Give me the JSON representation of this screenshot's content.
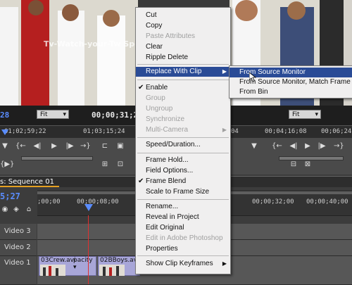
{
  "source_monitor": {
    "timecode_in": "28",
    "fit_label": "Fit",
    "timecode_current": "00;00;31;2",
    "ruler": [
      "01;02;59;22",
      "01;03;15;24"
    ],
    "watermark": "Tv-Watch-your-Tw Sports.com"
  },
  "program_monitor": {
    "fit_label": "Fit",
    "ruler": [
      "04",
      "00;04;16;08",
      "00;06;24;"
    ]
  },
  "timeline": {
    "tab_label": "s: Sequence 01",
    "timecode": "5;27",
    "ruler": [
      ";00;00",
      "00;00;08;00",
      "00;00;32;00",
      "00;00;40;00"
    ],
    "tracks": [
      {
        "label": "Video 3"
      },
      {
        "label": "Video 2"
      },
      {
        "label": "Video 1"
      }
    ],
    "clips": [
      {
        "label": "03Crew.avi",
        "extra": "pacity ▾"
      },
      {
        "label": "02BBoys.avi"
      }
    ]
  },
  "context_menu": {
    "items": [
      {
        "label": "Cut",
        "enabled": true
      },
      {
        "label": "Copy",
        "enabled": true
      },
      {
        "label": "Paste Attributes",
        "enabled": false
      },
      {
        "label": "Clear",
        "enabled": true
      },
      {
        "label": "Ripple Delete",
        "enabled": true
      },
      {
        "label": "Replace With Clip",
        "enabled": true,
        "submenu": true,
        "highlighted": true
      },
      {
        "label": "Enable",
        "enabled": true,
        "checked": true
      },
      {
        "label": "Group",
        "enabled": false
      },
      {
        "label": "Ungroup",
        "enabled": false
      },
      {
        "label": "Synchronize",
        "enabled": false
      },
      {
        "label": "Multi-Camera",
        "enabled": false,
        "submenu": true
      },
      {
        "label": "Speed/Duration...",
        "enabled": true
      },
      {
        "label": "Frame Hold...",
        "enabled": true
      },
      {
        "label": "Field Options...",
        "enabled": true
      },
      {
        "label": "Frame Blend",
        "enabled": true,
        "checked": true
      },
      {
        "label": "Scale to Frame Size",
        "enabled": true
      },
      {
        "label": "Rename...",
        "enabled": true
      },
      {
        "label": "Reveal in Project",
        "enabled": true
      },
      {
        "label": "Edit Original",
        "enabled": true
      },
      {
        "label": "Edit in Adobe Photoshop",
        "enabled": false
      },
      {
        "label": "Properties",
        "enabled": true
      },
      {
        "label": "Show Clip Keyframes",
        "enabled": true,
        "submenu": true
      }
    ]
  },
  "replace_submenu": {
    "items": [
      {
        "label": "From Source Monitor",
        "highlighted": true
      },
      {
        "label": "From Source Monitor, Match Frame"
      },
      {
        "label": "From Bin"
      }
    ]
  },
  "colors": {
    "menu_highlight": "#2a4b96",
    "timecode_blue": "#5a8dff",
    "playhead": "#e03030",
    "work_area": "#e4a021",
    "clip_fill": "#a8a6d8"
  }
}
